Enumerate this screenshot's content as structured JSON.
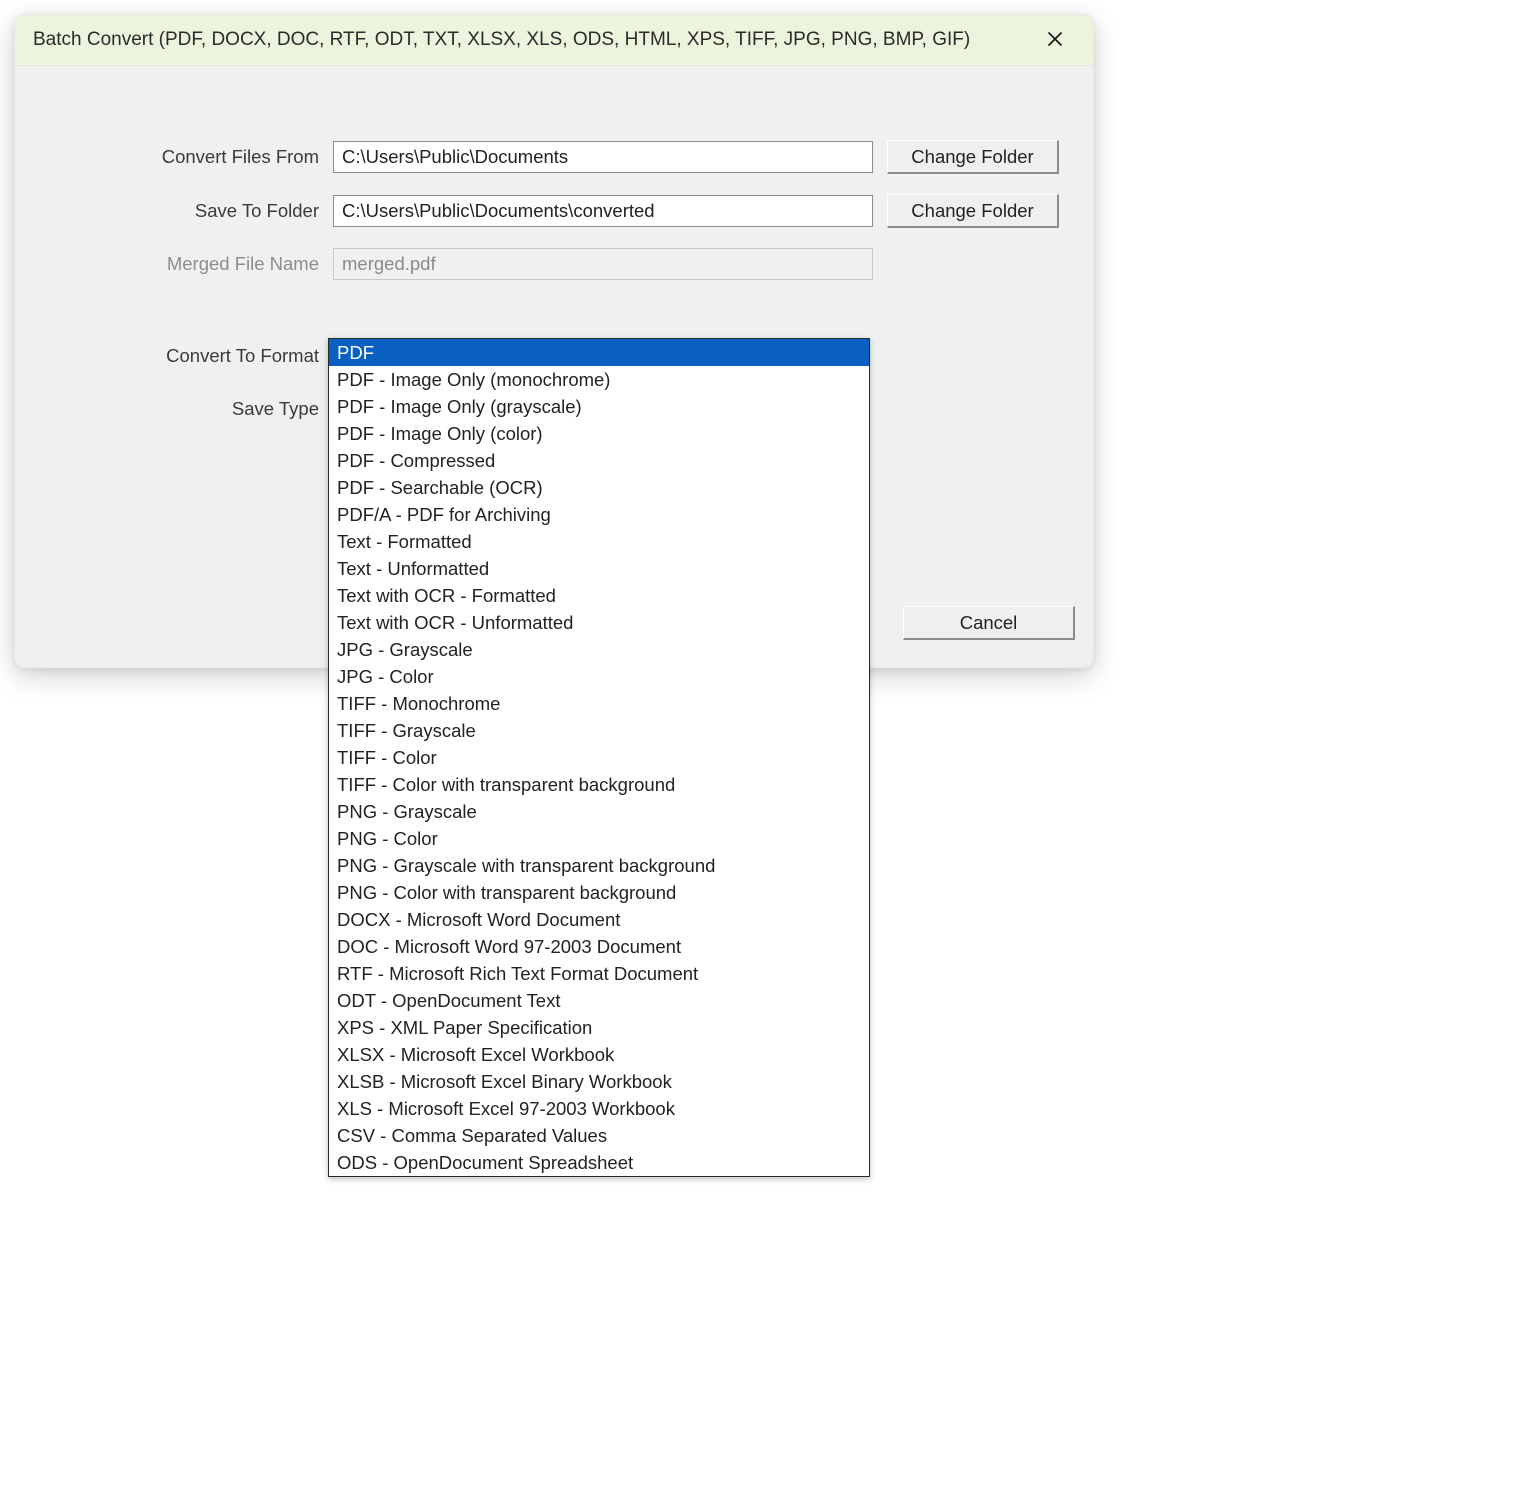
{
  "titlebar": {
    "title": "Batch Convert (PDF, DOCX, DOC, RTF, ODT, TXT, XLSX, XLS, ODS, HTML, XPS, TIFF, JPG, PNG, BMP, GIF)"
  },
  "labels": {
    "convert_from": "Convert Files From",
    "save_to": "Save To Folder",
    "merged_name": "Merged File Name",
    "convert_format": "Convert To Format",
    "save_type": "Save Type"
  },
  "values": {
    "convert_from": "C:\\Users\\Public\\Documents",
    "save_to": "C:\\Users\\Public\\Documents\\converted",
    "merged_name": "merged.pdf",
    "convert_format_selected": "PDF"
  },
  "buttons": {
    "change_folder": "Change Folder",
    "cancel": "Cancel"
  },
  "convert_format_options": [
    "PDF",
    "PDF - Image Only (monochrome)",
    "PDF - Image Only (grayscale)",
    "PDF - Image Only (color)",
    "PDF - Compressed",
    "PDF - Searchable (OCR)",
    "PDF/A - PDF for Archiving",
    "Text - Formatted",
    "Text - Unformatted",
    "Text with OCR - Formatted",
    "Text with OCR - Unformatted",
    "JPG - Grayscale",
    "JPG - Color",
    "TIFF - Monochrome",
    "TIFF - Grayscale",
    "TIFF - Color",
    "TIFF - Color with transparent background",
    "PNG - Grayscale",
    "PNG - Color",
    "PNG - Grayscale with transparent background",
    "PNG - Color with transparent background",
    "DOCX - Microsoft Word Document",
    "DOC - Microsoft Word 97-2003 Document",
    "RTF - Microsoft Rich Text Format Document",
    "ODT - OpenDocument Text",
    "XPS - XML Paper Specification",
    "XLSX - Microsoft Excel Workbook",
    "XLSB - Microsoft Excel Binary Workbook",
    "XLS - Microsoft Excel 97-2003 Workbook",
    "CSV - Comma Separated Values",
    "ODS - OpenDocument Spreadsheet"
  ],
  "convert_format_selected_index": 0
}
